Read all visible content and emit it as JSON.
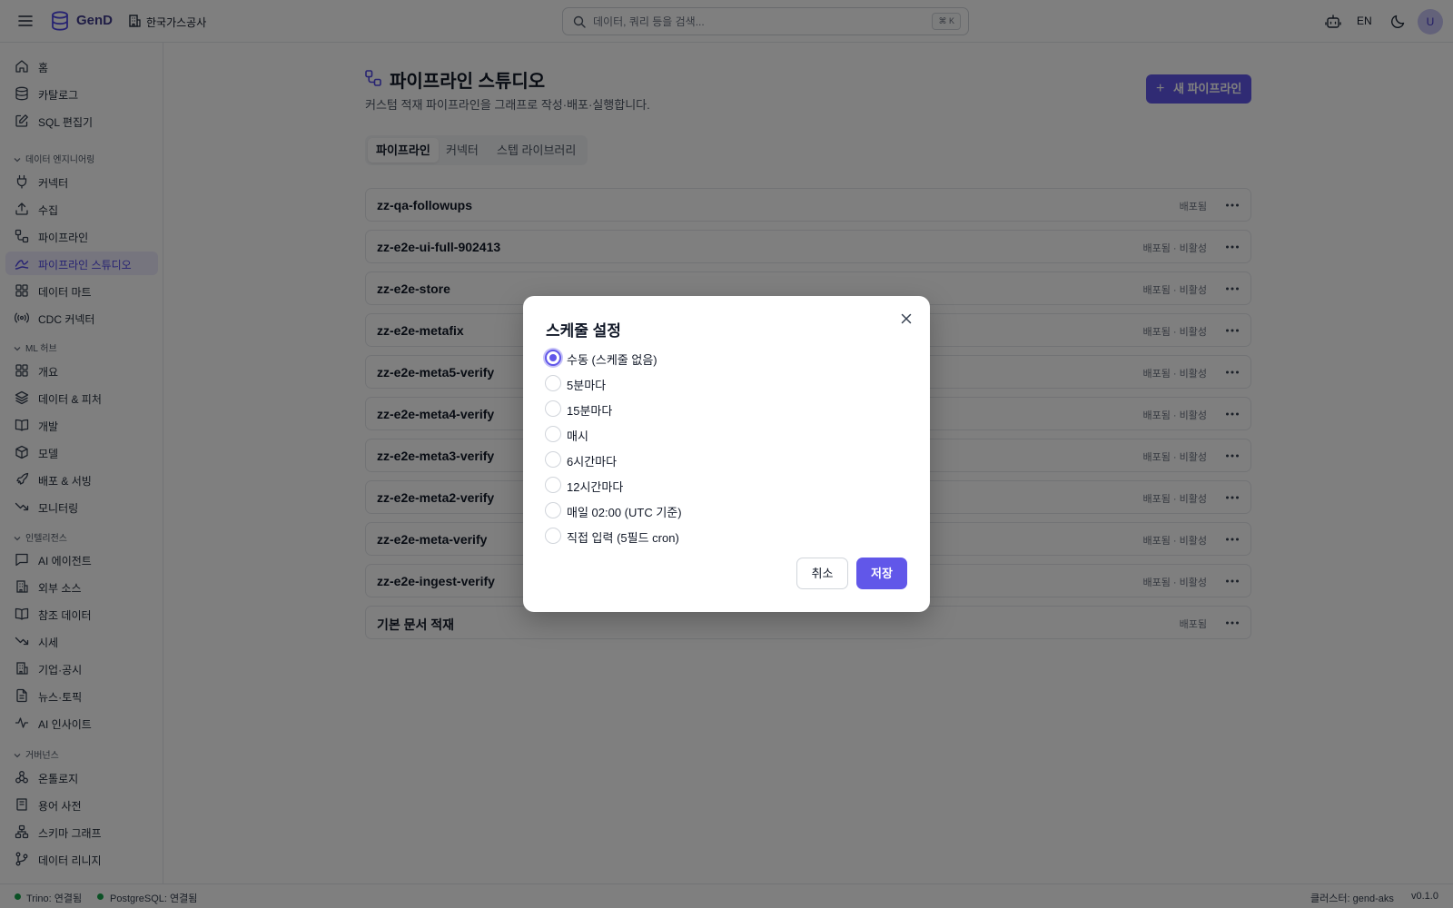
{
  "app": {
    "brand": "GenD",
    "org": "한국가스공사",
    "search_placeholder": "데이터, 쿼리 등을 검색...",
    "search_shortcut": "⌘ K",
    "lang": "EN",
    "avatar": "U",
    "accent": "#6157e9"
  },
  "sidebar": {
    "home": "홈",
    "catalog": "카탈로그",
    "sql_editor": "SQL 편집기",
    "sections": {
      "data_eng": "데이터 엔지니어링",
      "ml_hub": "ML 허브",
      "intel": "인텔리전스",
      "governance": "거버넌스"
    },
    "data_eng": [
      "커넥터",
      "수집",
      "파이프라인",
      "파이프라인 스튜디오",
      "데이터 마트",
      "CDC 커넥터"
    ],
    "ml_hub": [
      "개요",
      "데이터 & 피처",
      "개발",
      "모델",
      "배포 & 서빙",
      "모니터링"
    ],
    "intel": [
      "AI 에이전트",
      "외부 소스",
      "참조 데이터",
      "시세",
      "기업·공시",
      "뉴스·토픽",
      "AI 인사이트"
    ],
    "governance": [
      "온톨로지",
      "용어 사전",
      "스키마 그래프",
      "데이터 리니지"
    ]
  },
  "page": {
    "title": "파이프라인 스튜디오",
    "subtitle": "커스텀 적재 파이프라인을 그래프로 작성·배포·실행합니다.",
    "new_button": "새 파이프라인",
    "tabs": [
      "파이프라인",
      "커넥터",
      "스텝 라이브러리"
    ],
    "pipelines": [
      {
        "name": "zz-qa-followups",
        "status": "배포됨"
      },
      {
        "name": "zz-e2e-ui-full-902413",
        "status": "배포됨 · 비활성"
      },
      {
        "name": "zz-e2e-store",
        "status": "배포됨 · 비활성"
      },
      {
        "name": "zz-e2e-metafix",
        "status": "배포됨 · 비활성"
      },
      {
        "name": "zz-e2e-meta5-verify",
        "status": "배포됨 · 비활성"
      },
      {
        "name": "zz-e2e-meta4-verify",
        "status": "배포됨 · 비활성"
      },
      {
        "name": "zz-e2e-meta3-verify",
        "status": "배포됨 · 비활성"
      },
      {
        "name": "zz-e2e-meta2-verify",
        "status": "배포됨 · 비활성"
      },
      {
        "name": "zz-e2e-meta-verify",
        "status": "배포됨 · 비활성"
      },
      {
        "name": "zz-e2e-ingest-verify",
        "status": "배포됨 · 비활성"
      },
      {
        "name": "기본 문서 적재",
        "status": "배포됨"
      }
    ]
  },
  "statusbar": {
    "trino": "Trino: 연결됨",
    "postgres": "PostgreSQL: 연결됨",
    "cluster": "클러스터: gend-aks",
    "version": "v0.1.0"
  },
  "modal": {
    "title": "스케줄 설정",
    "selected_index": 0,
    "options": [
      "수동 (스케줄 없음)",
      "5분마다",
      "15분마다",
      "매시",
      "6시간마다",
      "12시간마다",
      "매일 02:00 (UTC 기준)",
      "직접 입력 (5필드 cron)"
    ],
    "cancel": "취소",
    "save": "저장"
  }
}
